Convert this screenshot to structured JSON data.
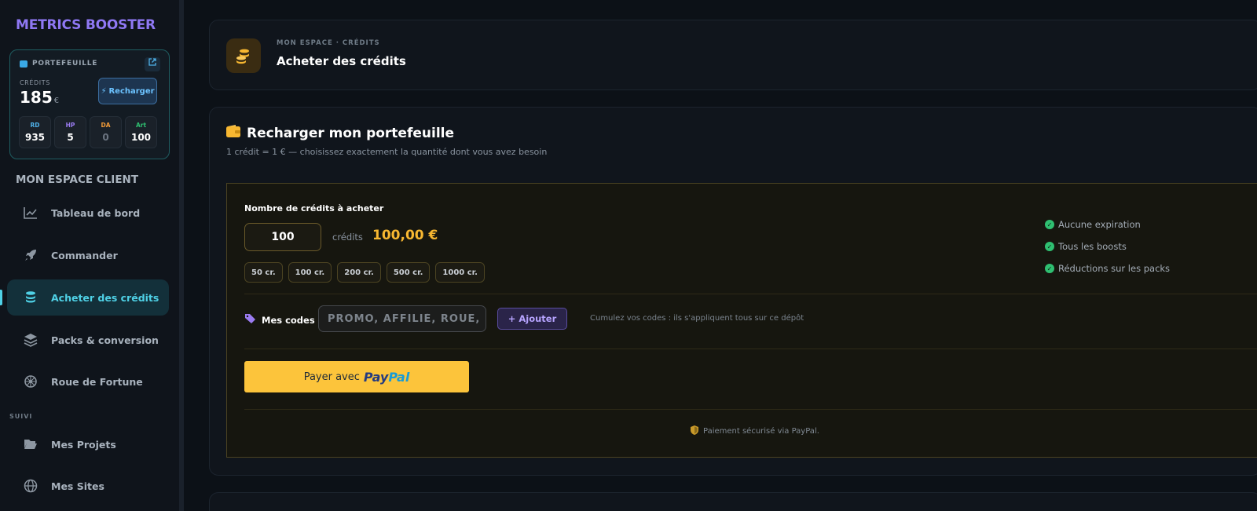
{
  "brand": "METRICS BOOSTER",
  "wallet": {
    "title": "PORTEFEUILLE",
    "credits_label": "CRÉDITS",
    "credits_value": "185",
    "credits_unit": "€",
    "recharge_label": "Recharger",
    "stats": [
      {
        "label": "RD",
        "value": "935",
        "color": "#4fb2ea"
      },
      {
        "label": "HP",
        "value": "5",
        "color": "#9b7cf2"
      },
      {
        "label": "DA",
        "value": "0",
        "color": "#f29b38"
      },
      {
        "label": "Art",
        "value": "100",
        "color": "#2fbf71"
      }
    ]
  },
  "sidebar": {
    "section_title": "MON ESPACE CLIENT",
    "items": [
      {
        "label": "Tableau de bord",
        "icon": "chart-line-icon"
      },
      {
        "label": "Commander",
        "icon": "rocket-icon"
      },
      {
        "label": "Acheter des crédits",
        "icon": "coins-icon",
        "active": true
      },
      {
        "label": "Packs & conversion",
        "icon": "layers-icon"
      },
      {
        "label": "Roue de Fortune",
        "icon": "wheel-icon"
      }
    ],
    "subsection": "SUIVI",
    "sub_items": [
      {
        "label": "Mes Projets",
        "icon": "folder-open-icon"
      },
      {
        "label": "Mes Sites",
        "icon": "globe-icon"
      }
    ]
  },
  "header": {
    "breadcrumb": "MON ESPACE · CRÉDITS",
    "title": "Acheter des crédits"
  },
  "panel": {
    "title": "Recharger mon portefeuille",
    "subtitle": "1 crédit = 1 € — choisissez exactement la quantité dont vous avez besoin",
    "qty_label": "Nombre de crédits à acheter",
    "qty_value": "100",
    "qty_unit": "crédits",
    "qty_price": "100,00 €",
    "presets": [
      "50 cr.",
      "100 cr.",
      "200 cr.",
      "500 cr.",
      "1000 cr."
    ],
    "features": [
      "Aucune expiration",
      "Tous les boosts",
      "Réductions sur les packs"
    ],
    "codes_label": "Mes codes",
    "codes_placeholder": "PROMO, AFFILIÉ, ROUE, P",
    "add_label": "Ajouter",
    "codes_hint": "Cumulez vos codes : ils s'appliquent tous sur ce dépôt",
    "pay_prefix": "Payer avec",
    "paypal_part1": "Pay",
    "paypal_part2": "Pal",
    "secure_text": "Paiement sécurisé via PayPal."
  },
  "colors": {
    "accent": "#4fd1e6",
    "brand": "#8f78f4",
    "price": "#f7b731",
    "paypal_button": "#fcc43b",
    "check": "#2fbf71"
  }
}
